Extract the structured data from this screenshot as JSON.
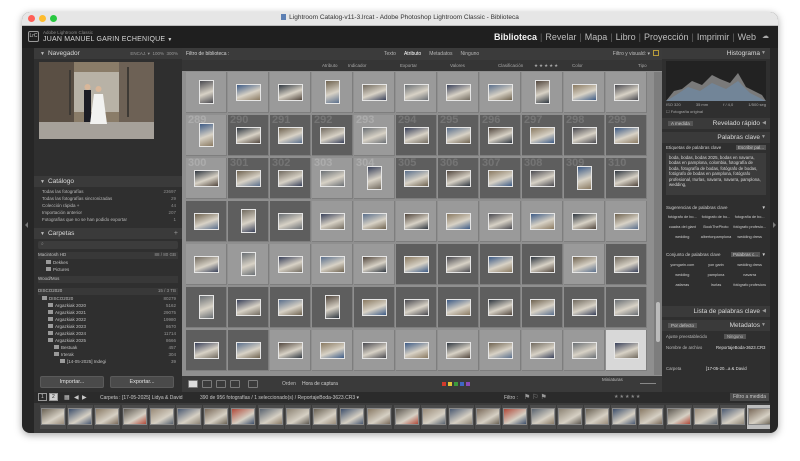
{
  "window": {
    "title": "Lightroom Catalog-v11-3.lrcat - Adobe Photoshop Lightroom Classic - Biblioteca"
  },
  "identity": {
    "app": "Adobe Lightroom Classic",
    "user": "JUAN MANUEL GARIN ECHENIQUE",
    "logo": "LrC"
  },
  "modules": [
    "Biblioteca",
    "Revelar",
    "Mapa",
    "Libro",
    "Proyección",
    "Imprimir",
    "Web"
  ],
  "active_module": "Biblioteca",
  "left_panel": {
    "navigator": {
      "title": "Navegador",
      "zoom_options": [
        "ENCAJ. ▾",
        "100%",
        "300%"
      ]
    },
    "catalog": {
      "title": "Catálogo",
      "items": [
        {
          "label": "Todas las fotografías",
          "count": "23697"
        },
        {
          "label": "Todas las fotografías sincronizadas",
          "count": "29"
        },
        {
          "label": "Colección rápida +",
          "count": "44"
        },
        {
          "label": "Importación anterior",
          "count": "207"
        },
        {
          "label": "Fotografías que no se han podido exportar",
          "count": "1"
        }
      ]
    },
    "folders": {
      "title": "Carpetas",
      "items": [
        {
          "label": "Macintosh HD",
          "count": "88 / 80 GB"
        },
        {
          "label": "Dekkes",
          "count": ""
        },
        {
          "label": "Pictures",
          "count": ""
        },
        {
          "label": "Wood/Mos",
          "count": ""
        },
        {
          "label": "DISCO2020",
          "count": "15 / 3 TB"
        },
        {
          "label": "DISCO2020",
          "count": "80279"
        },
        {
          "label": "Argazkiak 2020",
          "count": "5162"
        },
        {
          "label": "Argazkiak 2021",
          "count": "29075"
        },
        {
          "label": "Argazkiak 2022",
          "count": "19980"
        },
        {
          "label": "Argazkiak 2023",
          "count": "8670"
        },
        {
          "label": "Argazkiak 2024",
          "count": "11714"
        },
        {
          "label": "Argazkiak 2025",
          "count": "8666"
        },
        {
          "label": "Bestuak",
          "count": "457"
        },
        {
          "label": "Irterak",
          "count": "304"
        },
        {
          "label": "[14-05-2025] Indegi",
          "count": "39"
        }
      ]
    },
    "import_label": "Importar...",
    "export_label": "Exportar..."
  },
  "filter_bar": {
    "title": "Filtro de biblioteca :",
    "tabs": [
      "Texto",
      "Atributo",
      "Metadatos",
      "Ninguno"
    ],
    "active_tab": "Atributo",
    "right": "Filtro y visuald: ▾",
    "sub": [
      "Atributo",
      "Indicador",
      "Exportar",
      "Valores",
      "Clasificación",
      "Color",
      "Tipo"
    ]
  },
  "grid": {
    "numbers": [
      "289",
      "290",
      "291",
      "292",
      "293",
      "294",
      "295",
      "296",
      "297",
      "298",
      "299",
      "300",
      "301",
      "302",
      "303",
      "304",
      "305",
      "306",
      "307",
      "308",
      "309",
      "310",
      "311",
      "312",
      "313",
      "314",
      "315",
      "316",
      "317",
      "318",
      "319",
      "320",
      "321",
      "322",
      "323",
      "324",
      "325",
      "326",
      "327",
      "328",
      "329",
      "330",
      "331",
      "332",
      "333",
      "334",
      "335",
      "336",
      "337",
      "338",
      "339",
      "340",
      "341",
      "342",
      "343",
      "344",
      "345",
      "346",
      "347",
      "348",
      "349",
      "350",
      "351",
      "352",
      "353",
      "354",
      "355",
      "356",
      "357",
      "358",
      "359",
      "360"
    ]
  },
  "toolbar": {
    "order_label": "Orden",
    "order_value": "Hora de captura",
    "thumbnails_label": "Miniaturas"
  },
  "right_panel": {
    "histogram": {
      "title": "Histograma",
      "exif": [
        "ISO 320",
        "35 mm",
        "f / 4,0",
        "1/500 seg"
      ],
      "original": "Fotografía original"
    },
    "quick_develop": {
      "title": "Revelado rápido",
      "preset": "A medida"
    },
    "keywords": {
      "title": "Palabras clave",
      "tags_label": "Etiquetas de palabras clave",
      "tags_mode": "Escribir pal...",
      "keywords_text": "boda, bodas, bodas 2025, bodas en navarra, bodas en pamplona, colombia, fotografía de boda, fotografía de bodas, fotógrafo de bodas, fotógrafo de bodas en pamplona, fotógrafo profesional, Irurlas, navarra, navarra, pamplona, wedding,",
      "suggestions_title": "Sugerencias de palabras clave",
      "suggestions": [
        "fotógrafo de bo...",
        "fotógrafo de bo...",
        "fotografía de bo...",
        "cuadra del giant",
        "BookThePhoto",
        "fotógrafo profesio...",
        "wedding",
        "albertonpamplona",
        "wedding dress"
      ],
      "set_title": "Conjunto de palabras clave",
      "set_name": "Palabras c...",
      "set_items": [
        "yomgarin.com",
        "yon garin",
        "wedding dress",
        "wedding",
        "pamplona",
        "navarra",
        "asfarras",
        "Irurlas",
        "fotógrafo profesiona"
      ]
    },
    "keyword_list": {
      "title": "Lista de palabras clave"
    },
    "metadata": {
      "title": "Metadatos",
      "preset_label": "Por defecto",
      "preset_label2": "Ajuste preestablecido",
      "preset_value": "Ninguno",
      "filename_label": "Nombre de archivo",
      "filename_value": "ReportajeBoda-3623.CR3",
      "copy_label": "Carpeta",
      "copy_value": "[17-05-20...a & David"
    }
  },
  "filmstrip_bar": {
    "path": "Carpeta : [17-05-2025] Lidya & David",
    "info": "390 de 956 fotografías / 1 seleccionado(s) / ReportajeBoda-3623.CR3 ▾",
    "filter_label": "Filtro :",
    "filter_value": "Filtro a medida"
  },
  "colors": {
    "accent": "#dcdcdc",
    "label_red": "#d33a2c",
    "label_yellow": "#e3c43b",
    "label_green": "#3c9b3c",
    "label_blue": "#3f67c4",
    "label_purple": "#8b4ab8"
  }
}
